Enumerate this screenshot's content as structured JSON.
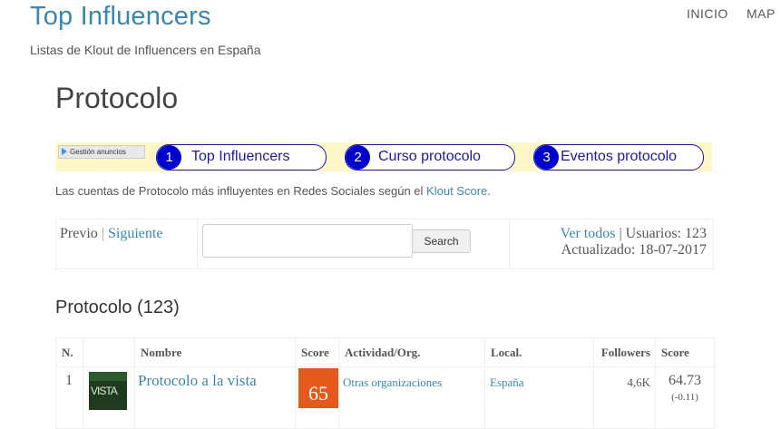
{
  "site": {
    "title": "Top Influencers",
    "tagline": "Listas de Klout de Influencers en España",
    "nav": [
      "INICIO",
      "MAP"
    ]
  },
  "page": {
    "title": "Protocolo"
  },
  "ads": {
    "label": "Gestión anuncios",
    "pills": [
      {
        "num": "1",
        "label": "Top Influencers"
      },
      {
        "num": "2",
        "label": "Curso protocolo"
      },
      {
        "num": "3",
        "label": "Eventos protocolo"
      }
    ]
  },
  "intro": {
    "text": "Las cuentas de Protocolo más influyentes en Redes Sociales según el",
    "link": "Klout Score",
    "end": "."
  },
  "pager": {
    "prev": "Previo",
    "sep": "|",
    "next": "Siguiente",
    "search_button": "Search",
    "search_value": "",
    "view_all": "Ver todos",
    "users": "| Usuarios: 123",
    "updated": "Actualizado: 18-07-2017"
  },
  "section": {
    "title": "Protocolo (123)"
  },
  "table": {
    "headers": [
      "N.",
      "",
      "Nombre",
      "Score",
      "Actividad/Org.",
      "Local.",
      "Followers",
      "Score"
    ],
    "rows": [
      {
        "n": "1",
        "thumb_text": "VISTA",
        "name": "Protocolo a la vista",
        "score": "65",
        "activity": "Otras organizaciones",
        "location": "España",
        "followers": "4,6K",
        "score_value": "64.73",
        "score_change": "(-0.11)"
      }
    ]
  }
}
